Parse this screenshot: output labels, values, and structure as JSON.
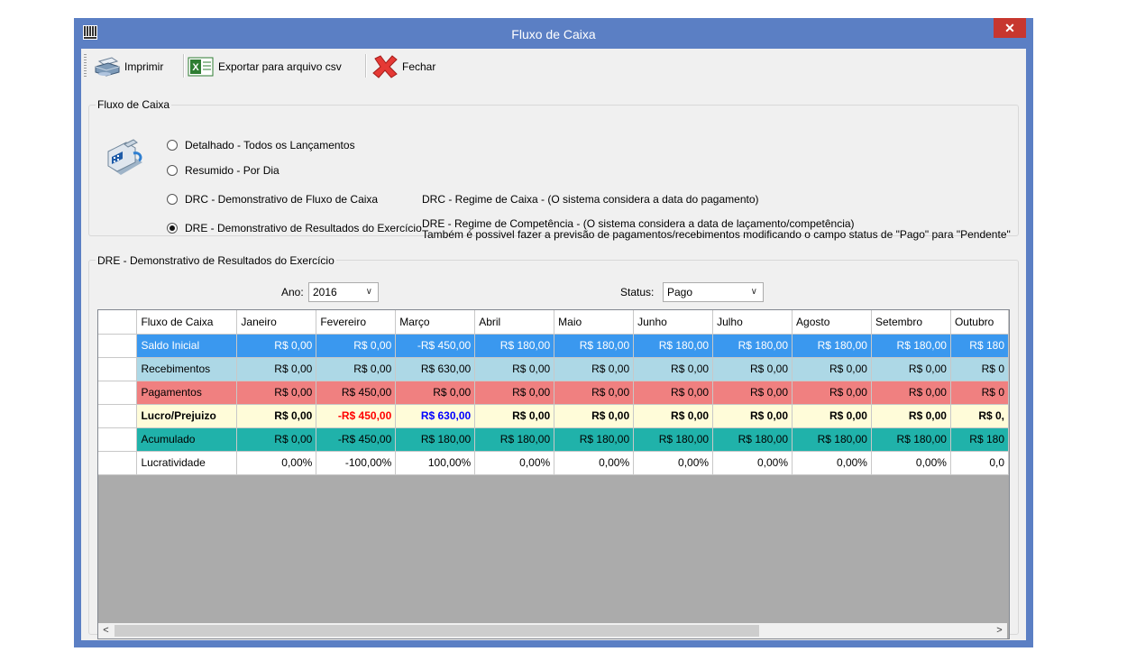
{
  "window": {
    "title": "Fluxo de Caixa",
    "close_glyph": "✕"
  },
  "toolbar": {
    "print_label": "Imprimir",
    "export_label": "Exportar para arquivo csv",
    "close_label": "Fechar"
  },
  "group_fluxo": {
    "legend": "Fluxo de Caixa",
    "options": [
      {
        "label": "Detalhado - Todos os Lançamentos",
        "checked": false
      },
      {
        "label": "Resumido - Por Dia",
        "checked": false
      },
      {
        "label": "DRC - Demonstrativo de Fluxo de Caixa",
        "checked": false
      },
      {
        "label": "DRE - Demonstrativo de Resultados do Exercício",
        "checked": true
      }
    ],
    "desc_drc": "DRC - Regime de Caixa  - (O sistema considera a data do pagamento)",
    "desc_dre_1": "DRE - Regime de Competência - (O sistema considera a data de laçamento/competência)",
    "desc_dre_2": "Também é possivel fazer a previsão de pagamentos/recebimentos modificando o campo status de \"Pago\" para \"Pendente\""
  },
  "group_dre": {
    "legend": "DRE - Demonstrativo de Resultados do Exercício",
    "ano_label": "Ano:",
    "ano_value": "2016",
    "status_label": "Status:",
    "status_value": "Pago"
  },
  "table": {
    "columns": [
      "Fluxo de Caixa",
      "Janeiro",
      "Fevereiro",
      "Março",
      "Abril",
      "Maio",
      "Junho",
      "Julho",
      "Agosto",
      "Setembro",
      "Outubro"
    ],
    "rows": [
      {
        "label": "Saldo Inicial",
        "values": [
          "R$ 0,00",
          "R$ 0,00",
          "-R$ 450,00",
          "R$ 180,00",
          "R$ 180,00",
          "R$ 180,00",
          "R$ 180,00",
          "R$ 180,00",
          "R$ 180,00",
          "R$ 180"
        ]
      },
      {
        "label": "Recebimentos",
        "values": [
          "R$ 0,00",
          "R$ 0,00",
          "R$ 630,00",
          "R$ 0,00",
          "R$ 0,00",
          "R$ 0,00",
          "R$ 0,00",
          "R$ 0,00",
          "R$ 0,00",
          "R$ 0"
        ]
      },
      {
        "label": "Pagamentos",
        "values": [
          "R$ 0,00",
          "R$ 450,00",
          "R$ 0,00",
          "R$ 0,00",
          "R$ 0,00",
          "R$ 0,00",
          "R$ 0,00",
          "R$ 0,00",
          "R$ 0,00",
          "R$ 0"
        ]
      },
      {
        "label": "Lucro/Prejuizo",
        "values": [
          "R$ 0,00",
          "-R$ 450,00",
          "R$ 630,00",
          "R$ 0,00",
          "R$ 0,00",
          "R$ 0,00",
          "R$ 0,00",
          "R$ 0,00",
          "R$ 0,00",
          "R$ 0,"
        ]
      },
      {
        "label": "Acumulado",
        "values": [
          "R$ 0,00",
          "-R$ 450,00",
          "R$ 180,00",
          "R$ 180,00",
          "R$ 180,00",
          "R$ 180,00",
          "R$ 180,00",
          "R$ 180,00",
          "R$ 180,00",
          "R$ 180"
        ]
      },
      {
        "label": "Lucratividade",
        "values": [
          "0,00%",
          "-100,00%",
          "100,00%",
          "0,00%",
          "0,00%",
          "0,00%",
          "0,00%",
          "0,00%",
          "0,00%",
          "0,0"
        ]
      }
    ],
    "current_row_marker": "▶"
  },
  "colors": {
    "title_bar": "#5b7fc4",
    "saldo_inicial": "#3a98ef",
    "recebimentos": "#add8e6",
    "pagamentos": "#f08080",
    "lucro_prejuizo": "#fffcd9",
    "acumulado": "#20b2aa",
    "negative_text": "#ff0000",
    "positive_text": "#0000ff"
  },
  "icons": {
    "app": "grid-icon",
    "print": "printer-icon",
    "export": "excel-icon",
    "close": "red-x-icon",
    "group": "cash-register-icon"
  }
}
